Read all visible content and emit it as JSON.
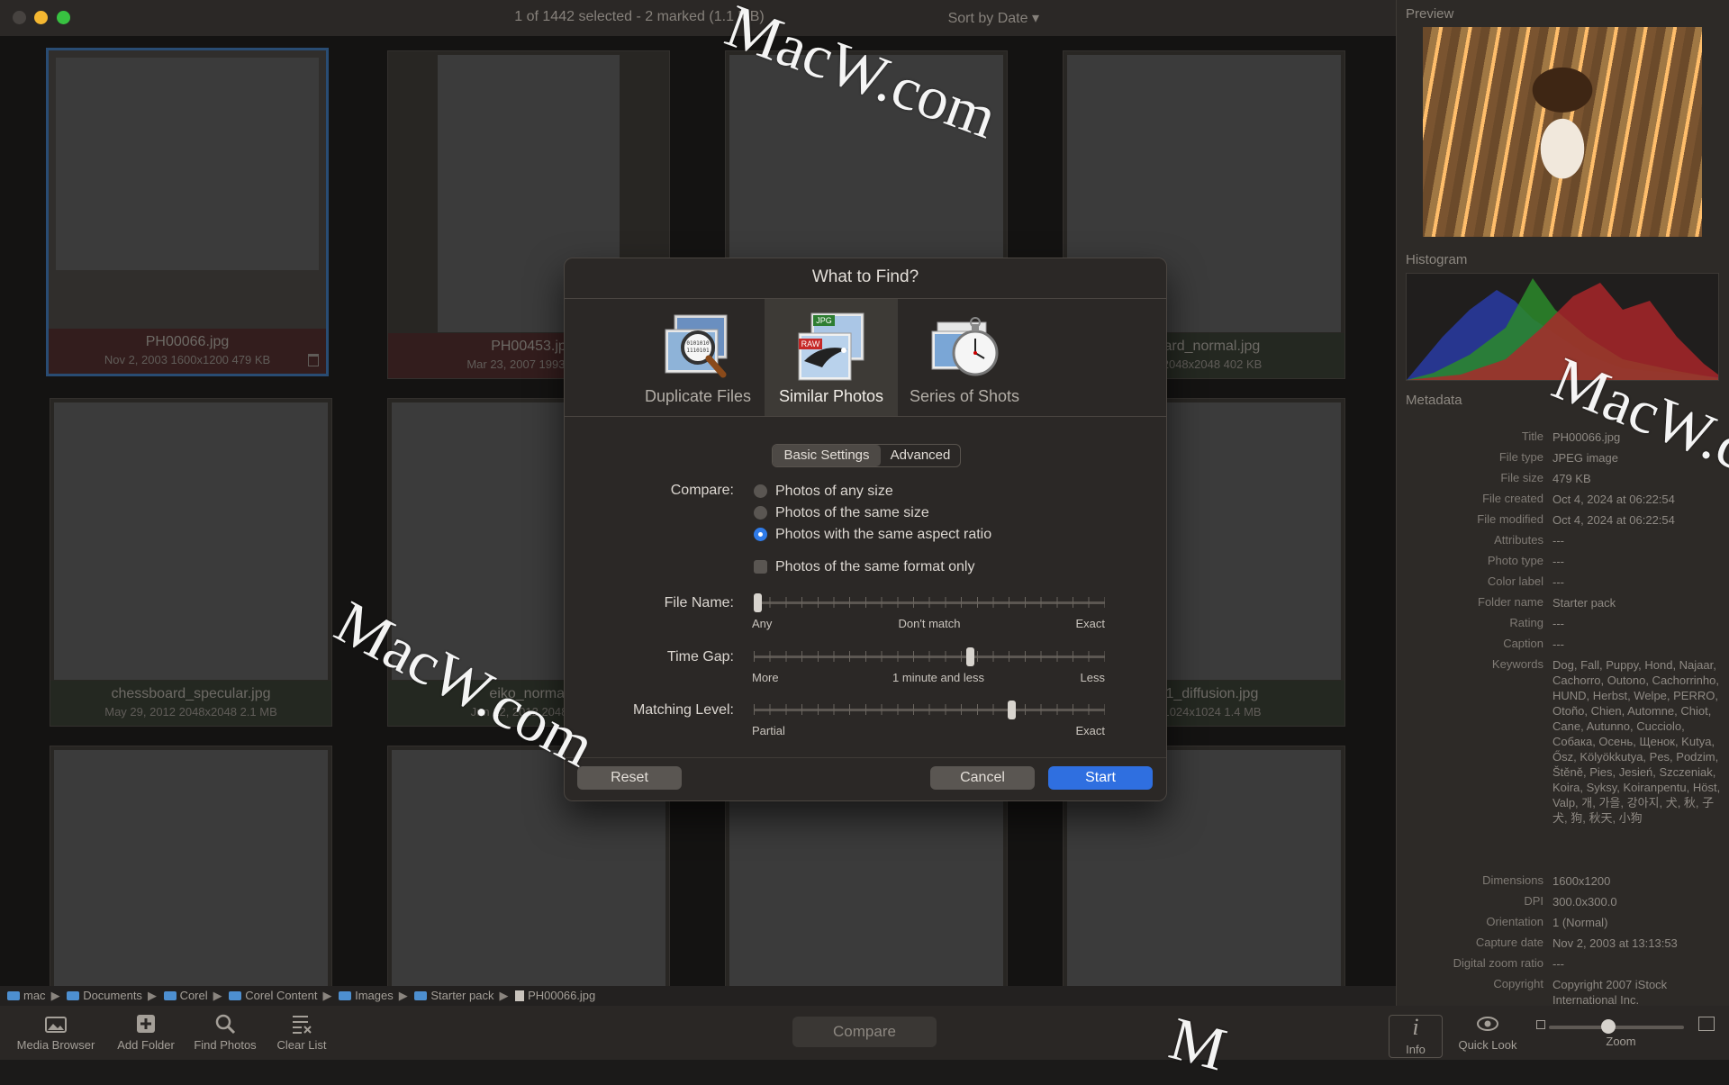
{
  "window": {
    "title": "1 of 1442 selected - 2 marked (1.1 MB)",
    "sort_label": "Sort by Date ▾"
  },
  "thumbnails": [
    {
      "name": "PH00066.jpg",
      "meta": "Nov 2, 2003  1600x1200  479 KB"
    },
    {
      "name": "PH00453.jp",
      "meta": "Mar 23, 2007  1993x300"
    },
    {
      "name": "",
      "meta": ""
    },
    {
      "name": "board_normal.jpg",
      "meta": "12  2048x2048  402 KB"
    },
    {
      "name": "chessboard_specular.jpg",
      "meta": "May 29, 2012  2048x2048  2.1 MB"
    },
    {
      "name": "eiko_normal",
      "meta": "Jun 12, 2012  2048x20"
    },
    {
      "name": "",
      "meta": ""
    },
    {
      "name": "_01_diffusion.jpg",
      "meta": "12  1024x1024  1.4 MB"
    }
  ],
  "path": [
    "mac",
    "Documents",
    "Corel",
    "Corel Content",
    "Images",
    "Starter pack",
    "PH00066.jpg"
  ],
  "toolbar": {
    "media_browser": "Media Browser",
    "add_folder": "Add Folder",
    "find_photos": "Find Photos",
    "clear_list": "Clear List",
    "compare": "Compare",
    "info": "Info",
    "quick_look": "Quick Look",
    "zoom": "Zoom"
  },
  "panel": {
    "preview": "Preview",
    "histogram": "Histogram",
    "metadata": "Metadata",
    "rows": [
      {
        "k": "Title",
        "v": "PH00066.jpg"
      },
      {
        "k": "File type",
        "v": "JPEG image"
      },
      {
        "k": "File size",
        "v": "479 KB"
      },
      {
        "k": "File created",
        "v": "Oct 4, 2024 at 06:22:54"
      },
      {
        "k": "File modified",
        "v": "Oct 4, 2024 at 06:22:54"
      },
      {
        "k": "Attributes",
        "v": "---"
      },
      {
        "k": "Photo type",
        "v": "---"
      },
      {
        "k": "Color label",
        "v": "---"
      },
      {
        "k": "Folder name",
        "v": "Starter pack"
      },
      {
        "k": "Rating",
        "v": "---"
      },
      {
        "k": "Caption",
        "v": "---"
      },
      {
        "k": "Keywords",
        "v": "Dog, Fall, Puppy, Hond, Najaar, Cachorro, Outono, Cachorrinho, HUND, Herbst, Welpe, PERRO, Otoño, Chien, Automne, Chiot, Cane, Autunno, Cucciolo, Собака, Осень, Щенок, Kutya, Ősz, Kölyökkutya, Pes, Podzim, Štěně, Pies, Jesień, Szczeniak, Koira, Syksy, Koiranpentu, Höst, Valp, 개, 가을, 강아지, 犬, 秋, 子犬, 狗, 秋天, 小狗"
      },
      {
        "k": "Dimensions",
        "v": "1600x1200"
      },
      {
        "k": "DPI",
        "v": "300.0x300.0"
      },
      {
        "k": "Orientation",
        "v": "1 (Normal)"
      },
      {
        "k": "Capture date",
        "v": "Nov 2, 2003 at 13:13:53"
      },
      {
        "k": "Digital zoom ratio",
        "v": "---"
      },
      {
        "k": "Copyright",
        "v": "Copyright 2007 iStock International Inc."
      }
    ]
  },
  "dialog": {
    "title": "What to Find?",
    "modes": [
      "Duplicate Files",
      "Similar Photos",
      "Series of Shots"
    ],
    "active_mode": "Similar Photos",
    "icon_badges": {
      "jpg": "JPG",
      "raw": "RAW"
    },
    "tabs": [
      "Basic Settings",
      "Advanced"
    ],
    "compare_label": "Compare:",
    "compare_options": [
      "Photos of any size",
      "Photos of the same size",
      "Photos with the same aspect ratio"
    ],
    "compare_selected": 2,
    "format_only": "Photos of the same format only",
    "format_only_checked": false,
    "file_name": {
      "label": "File Name:",
      "min": "Any",
      "mid": "Don't match",
      "max": "Exact",
      "position": 0.0
    },
    "time_gap": {
      "label": "Time Gap:",
      "min": "More",
      "mid": "1 minute and less",
      "max": "Less",
      "position": 0.62
    },
    "matching_level": {
      "label": "Matching Level:",
      "min": "Partial",
      "max": "Exact",
      "position": 0.74
    },
    "reset": "Reset",
    "cancel": "Cancel",
    "start": "Start"
  },
  "watermarks": [
    "MacW.com",
    "MacW.com",
    "MacW.c",
    "M"
  ],
  "colors": {
    "accent": "#2f6fe0",
    "selection": "#3b6ea5"
  }
}
